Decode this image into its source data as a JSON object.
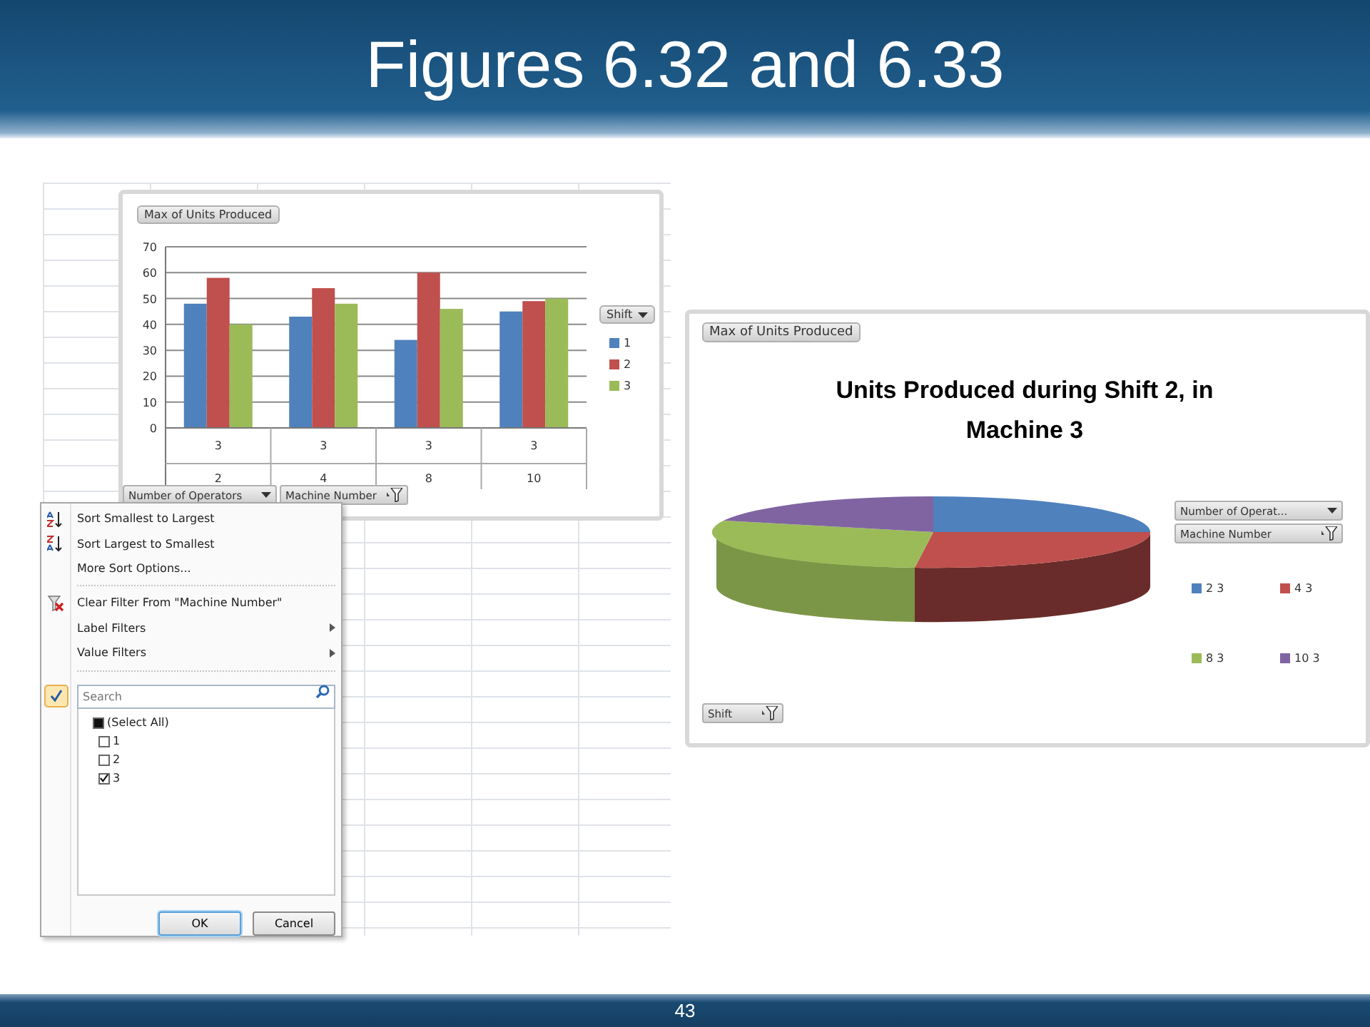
{
  "slide": {
    "title": "Figures 6.32 and 6.33",
    "page_number": "43"
  },
  "bar_chart_panel": {
    "value_field": "Max of Units Produced",
    "legend_title": "Shift",
    "axis_fields": [
      {
        "label": "Number of Operators",
        "filtered": false
      },
      {
        "label": "Machine Number",
        "filtered": true
      }
    ],
    "category_sublabels": [
      "3",
      "3",
      "3",
      "3"
    ],
    "chart_data": {
      "type": "bar",
      "grid": true,
      "categories": [
        "2",
        "4",
        "8",
        "10"
      ],
      "ylim": [
        0,
        70
      ],
      "yticks": [
        0,
        10,
        20,
        30,
        40,
        50,
        60,
        70
      ],
      "series": [
        {
          "name": "1",
          "color": "#4f81bd",
          "values": [
            48,
            43,
            34,
            45
          ]
        },
        {
          "name": "2",
          "color": "#c0504d",
          "values": [
            58,
            54,
            60,
            49
          ]
        },
        {
          "name": "3",
          "color": "#9bbb59",
          "values": [
            40,
            48,
            46,
            50
          ]
        }
      ]
    }
  },
  "filter_menu": {
    "items": [
      {
        "label": "Sort Smallest to Largest",
        "kind": "sort-asc"
      },
      {
        "label": "Sort Largest to Smallest",
        "kind": "sort-desc"
      },
      {
        "label": "More Sort Options...",
        "kind": "plain"
      },
      {
        "label": "Clear Filter From \"Machine Number\"",
        "kind": "clear-filter"
      },
      {
        "label": "Label Filters",
        "kind": "submenu"
      },
      {
        "label": "Value Filters",
        "kind": "submenu"
      }
    ],
    "search": {
      "placeholder": "Search"
    },
    "values": [
      {
        "label": "(Select All)",
        "checked": false,
        "indeterminate": true
      },
      {
        "label": "1",
        "checked": false,
        "indeterminate": false
      },
      {
        "label": "2",
        "checked": false,
        "indeterminate": false
      },
      {
        "label": "3",
        "checked": true,
        "indeterminate": false
      }
    ],
    "buttons": [
      {
        "label": "OK",
        "default": true
      },
      {
        "label": "Cancel",
        "default": false
      }
    ]
  },
  "pie_chart_panel": {
    "value_field": "Max of Units Produced",
    "title": "Units Produced during Shift 2, in Machine 3",
    "axis_fields": [
      {
        "label": "Number of Operat...",
        "filtered": false
      },
      {
        "label": "Machine Number",
        "filtered": true
      }
    ],
    "legend": [
      {
        "label": "2 3",
        "color": "#4f81bd"
      },
      {
        "label": "4 3",
        "color": "#c0504d"
      },
      {
        "label": "8 3",
        "color": "#9bbb59"
      },
      {
        "label": "10 3",
        "color": "#8064a2"
      }
    ],
    "filter_field": {
      "label": "Shift",
      "filtered": true
    }
  }
}
